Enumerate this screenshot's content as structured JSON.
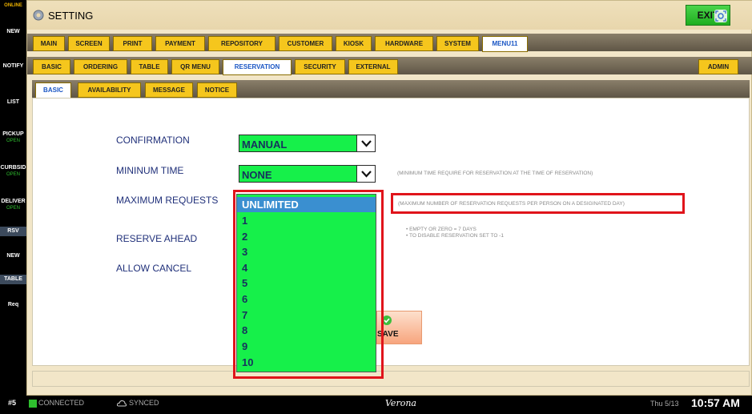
{
  "sidebar": {
    "online": "ONLINE",
    "items": [
      {
        "label": "NEW"
      },
      {
        "label": "NOTIFY"
      },
      {
        "label": "LIST"
      },
      {
        "label": "PICKUP",
        "sub": "OPEN"
      },
      {
        "label": "CURBSID",
        "sub": "OPEN"
      },
      {
        "label": "DELIVER",
        "sub": "OPEN"
      },
      {
        "label": "RSV"
      },
      {
        "label": "NEW"
      },
      {
        "label": "TABLE"
      },
      {
        "label": "Req"
      }
    ]
  },
  "header": {
    "title": "SETTING",
    "exit_label": "EXIT"
  },
  "main_tabs": [
    "MAIN",
    "SCREEN",
    "PRINT",
    "PAYMENT",
    "REPOSITORY",
    "CUSTOMER",
    "KIOSK",
    "HARDWARE",
    "SYSTEM",
    "MENU11"
  ],
  "sub_tabs": [
    "BASIC",
    "ORDERING",
    "TABLE",
    "QR MENU",
    "RESERVATION",
    "SECURITY",
    "EXTERNAL"
  ],
  "admin_label": "ADMIN",
  "third_tabs": [
    "BASIC",
    "AVAILABILITY",
    "MESSAGE",
    "NOTICE"
  ],
  "form": {
    "confirmation_label": "CONFIRMATION",
    "confirmation_value": "MANUAL",
    "min_time_label": "MININUM TIME",
    "min_time_value": "NONE",
    "min_time_note": "(MINIMUM TIME REQUIRE FOR RESERVATION AT THE TIME OF RESERVATION)",
    "max_requests_label": "MAXIMUM REQUESTS",
    "max_requests_note": "(MAXIMUM NUMBER OF RESERVATION REQUESTS PER PERSON ON A DESIGINATED DAY)",
    "reserve_ahead_label": "RESERVE AHEAD",
    "reserve_ahead_note1": "•  EMPTY OR ZERO = 7 DAYS",
    "reserve_ahead_note2": "•  TO DISABLE RESERVATION SET TO -1",
    "allow_cancel_label": "ALLOW CANCEL",
    "dropdown_options": [
      "UNLIMITED",
      "1",
      "2",
      "3",
      "4",
      "5",
      "6",
      "7",
      "8",
      "9",
      "10"
    ],
    "save_label": "SAVE"
  },
  "status": {
    "station": "#5",
    "connected": "CONNECTED",
    "synced": "SYNCED",
    "location": "Verona",
    "date": "Thu 5/13",
    "time": "10:57 AM"
  }
}
